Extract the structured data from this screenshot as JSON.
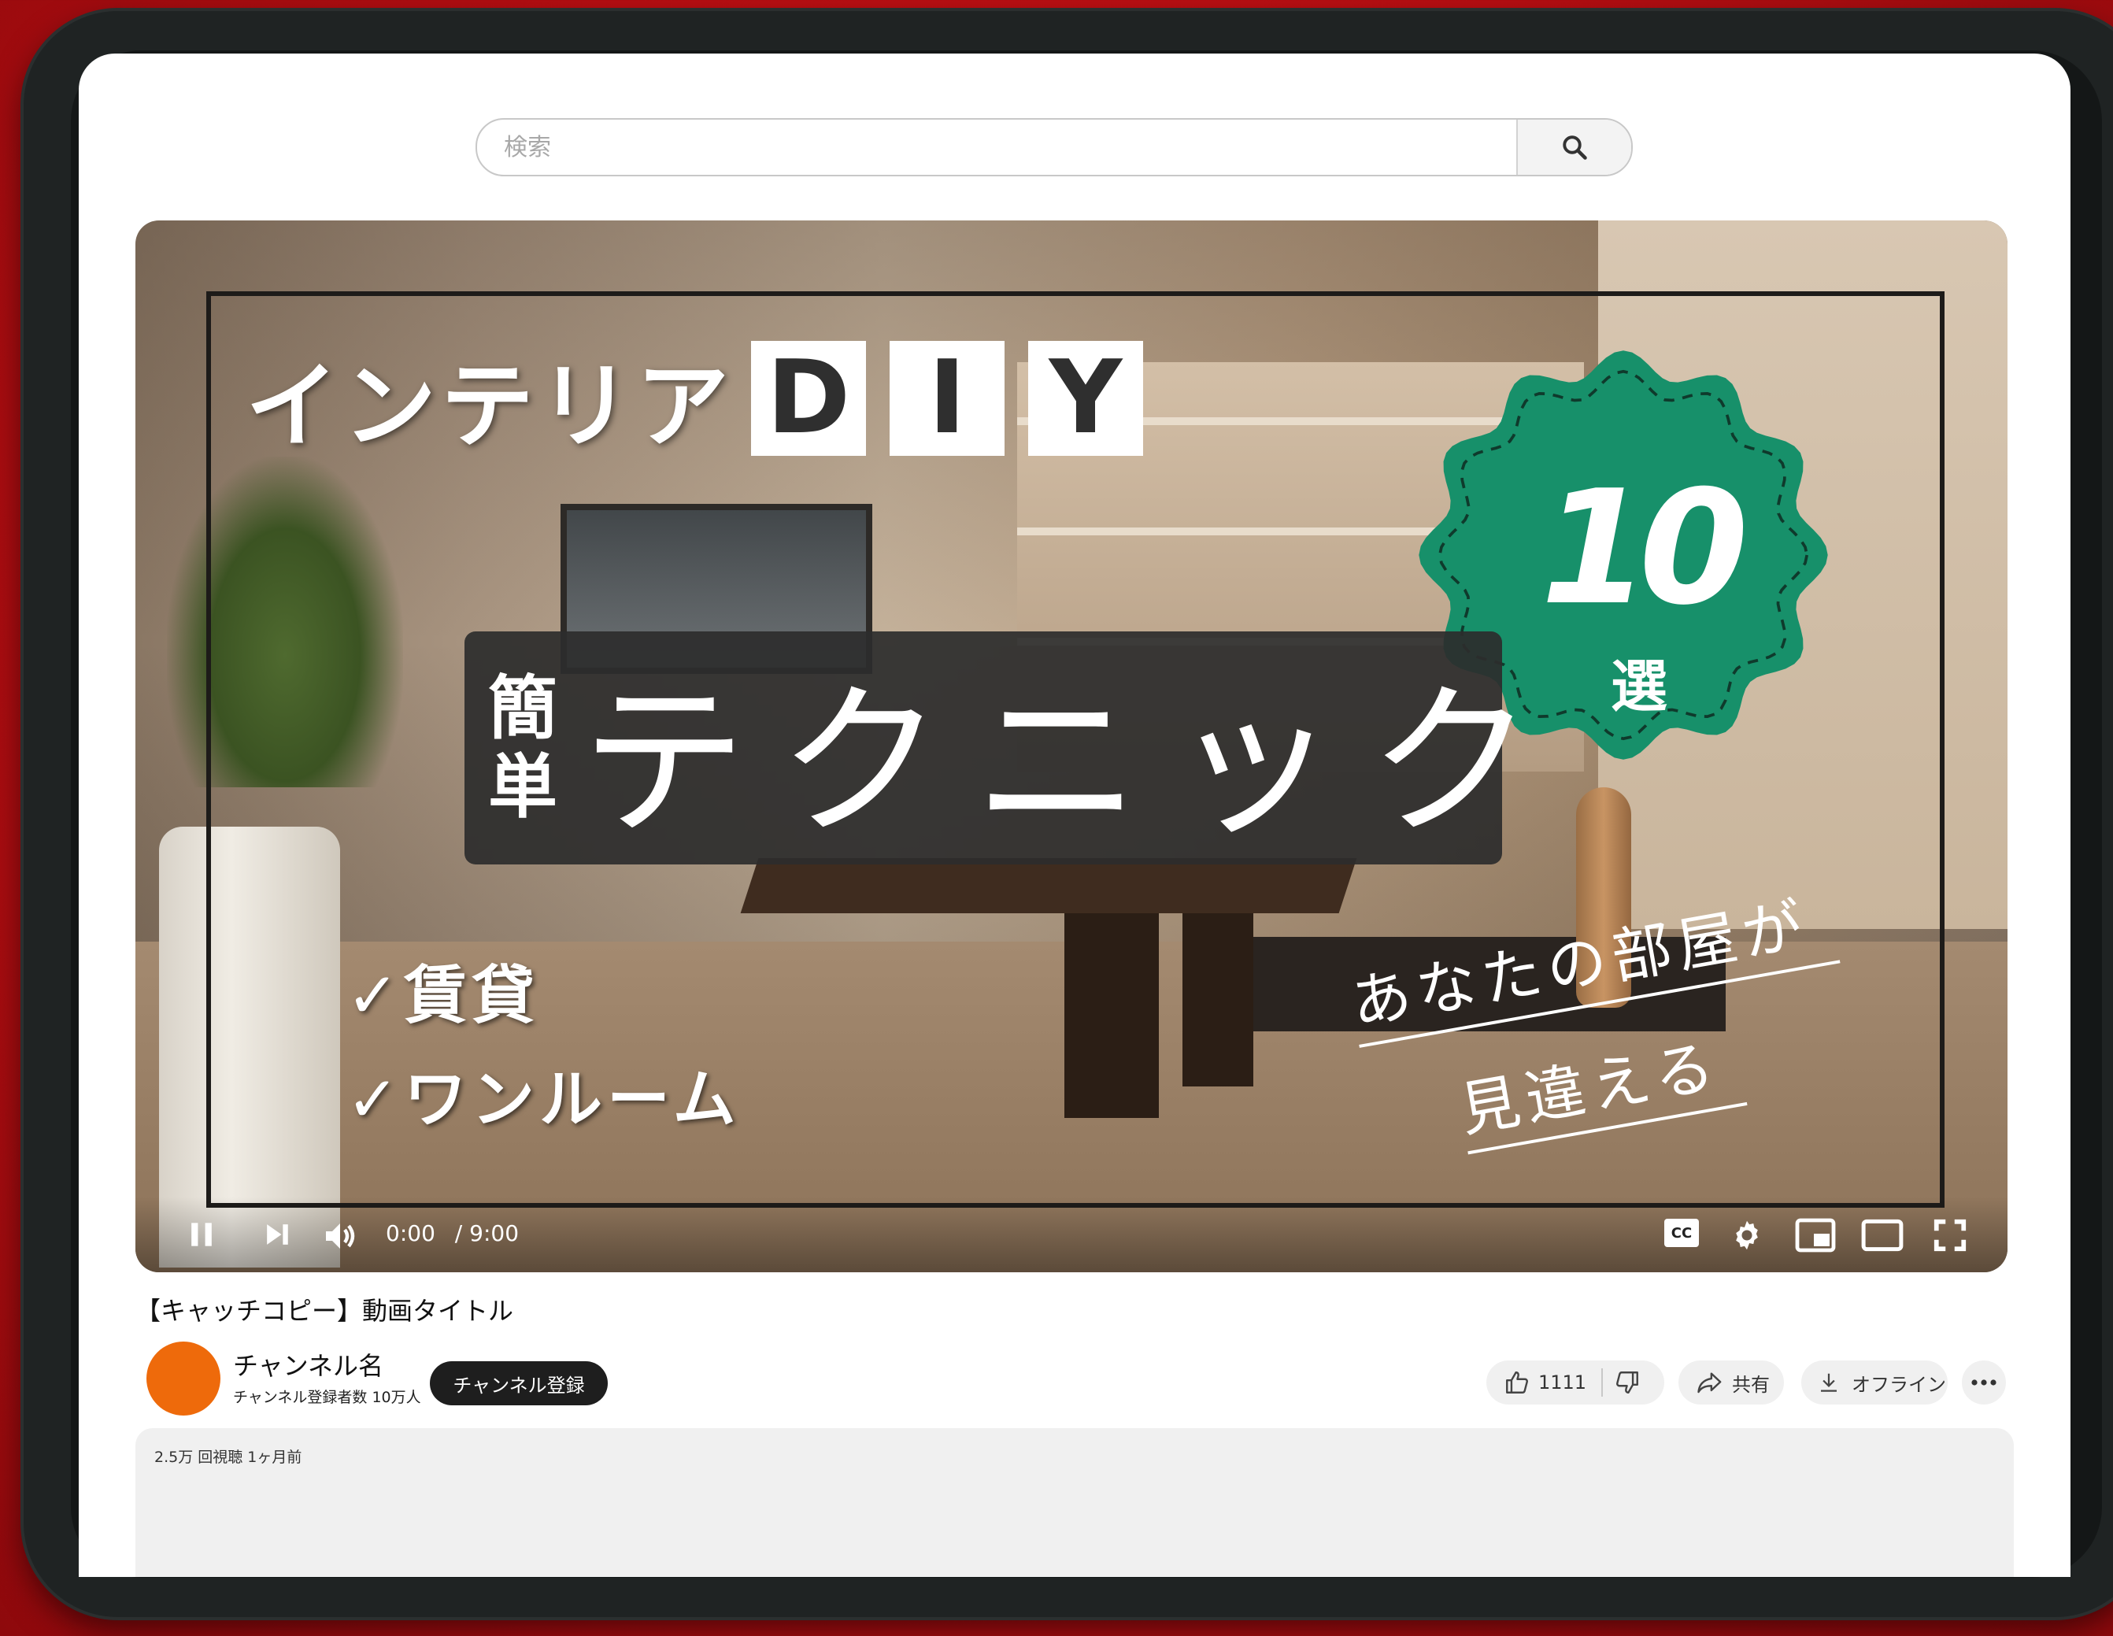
{
  "search": {
    "placeholder": "検索"
  },
  "thumbnail": {
    "title_main": "インテリア",
    "title_letters": [
      "D",
      "I",
      "Y"
    ],
    "badge_number": "10",
    "badge_suffix": "選",
    "technic_small": [
      "簡",
      "単"
    ],
    "technic_big": "テクニック",
    "checklist": [
      "✓賃貸",
      "✓ワンルーム"
    ],
    "handwritten": [
      "あなたの部屋が",
      "見違える"
    ],
    "badge_color": "#17906a"
  },
  "player": {
    "current_time": "0:00",
    "duration": "/ 9:00",
    "cc_label": "CC",
    "icons": [
      "pause-icon",
      "next-icon",
      "volume-icon",
      "cc-icon",
      "settings-icon",
      "miniplayer-icon",
      "theater-icon",
      "fullscreen-icon"
    ]
  },
  "video": {
    "title": "【キャッチコピー】動画タイトル",
    "channel_name": "チャンネル名",
    "subscribers": "チャンネル登録者数 10万人",
    "subscribe_label": "チャンネル登録",
    "like_count": "1111",
    "share_label": "共有",
    "offline_label": "オフライン",
    "meta": "2.5万 回視聴 1ヶ月前"
  },
  "colors": {
    "accent_red": "#c4101a",
    "avatar_orange": "#ee6a0b",
    "device_frame": "#1f2323"
  }
}
